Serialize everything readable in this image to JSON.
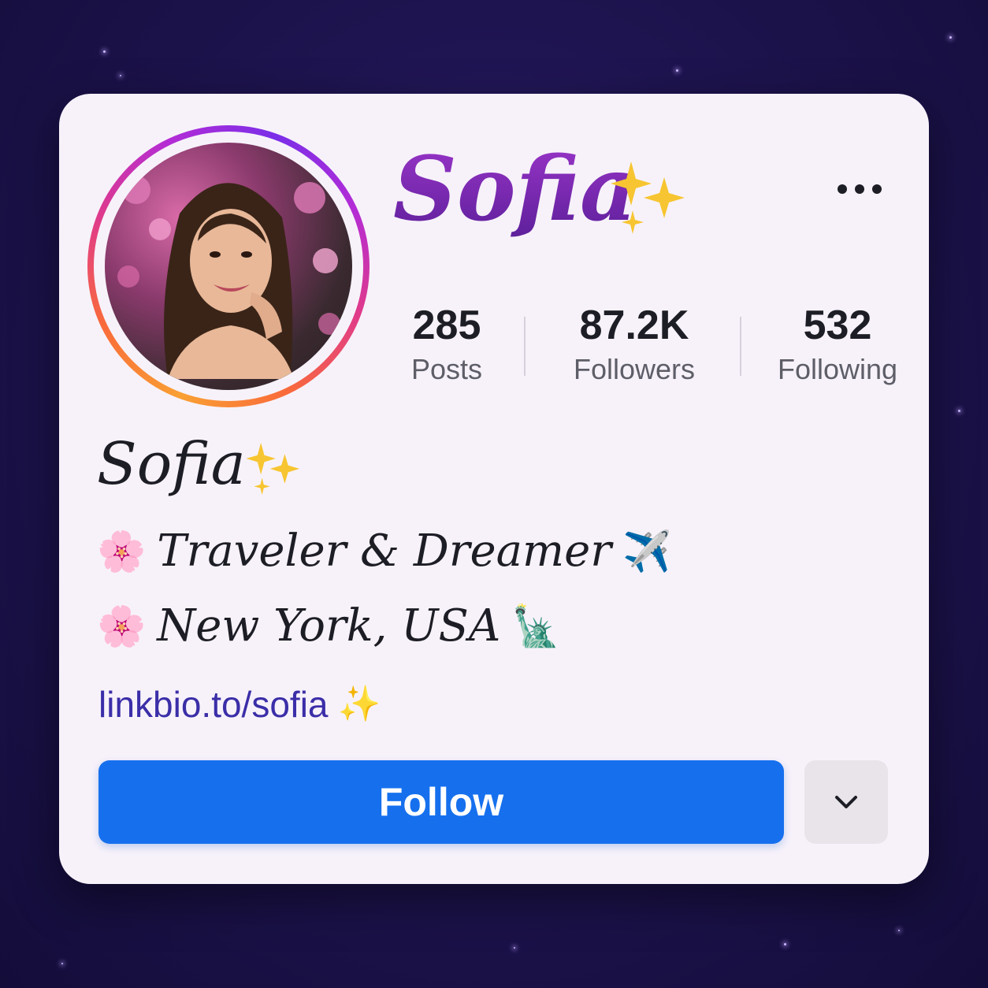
{
  "profile": {
    "header_name": "Sofia",
    "display_name": "Sofia",
    "bio_lines": [
      {
        "emoji": "🌸",
        "text": "Traveler & Dreamer",
        "trailing_emoji": "✈️"
      },
      {
        "emoji": "🌸",
        "text": "New York, USA",
        "trailing_emoji": "🗽"
      }
    ],
    "link": "linkbio.to/sofia",
    "sparkle": "✨"
  },
  "stats": [
    {
      "value": "285",
      "label": "Posts"
    },
    {
      "value": "87.2K",
      "label": "Followers"
    },
    {
      "value": "532",
      "label": "Following"
    }
  ],
  "actions": {
    "follow_label": "Follow",
    "more_icon": "more-horizontal-icon",
    "dropdown_icon": "chevron-down-icon"
  },
  "colors": {
    "follow_button": "#1670ee",
    "link": "#3b2ea8",
    "name_gradient_top": "#9b35c9",
    "name_gradient_bottom": "#5b1f99",
    "background": "#1e1450",
    "card": "#f7f2fa"
  }
}
